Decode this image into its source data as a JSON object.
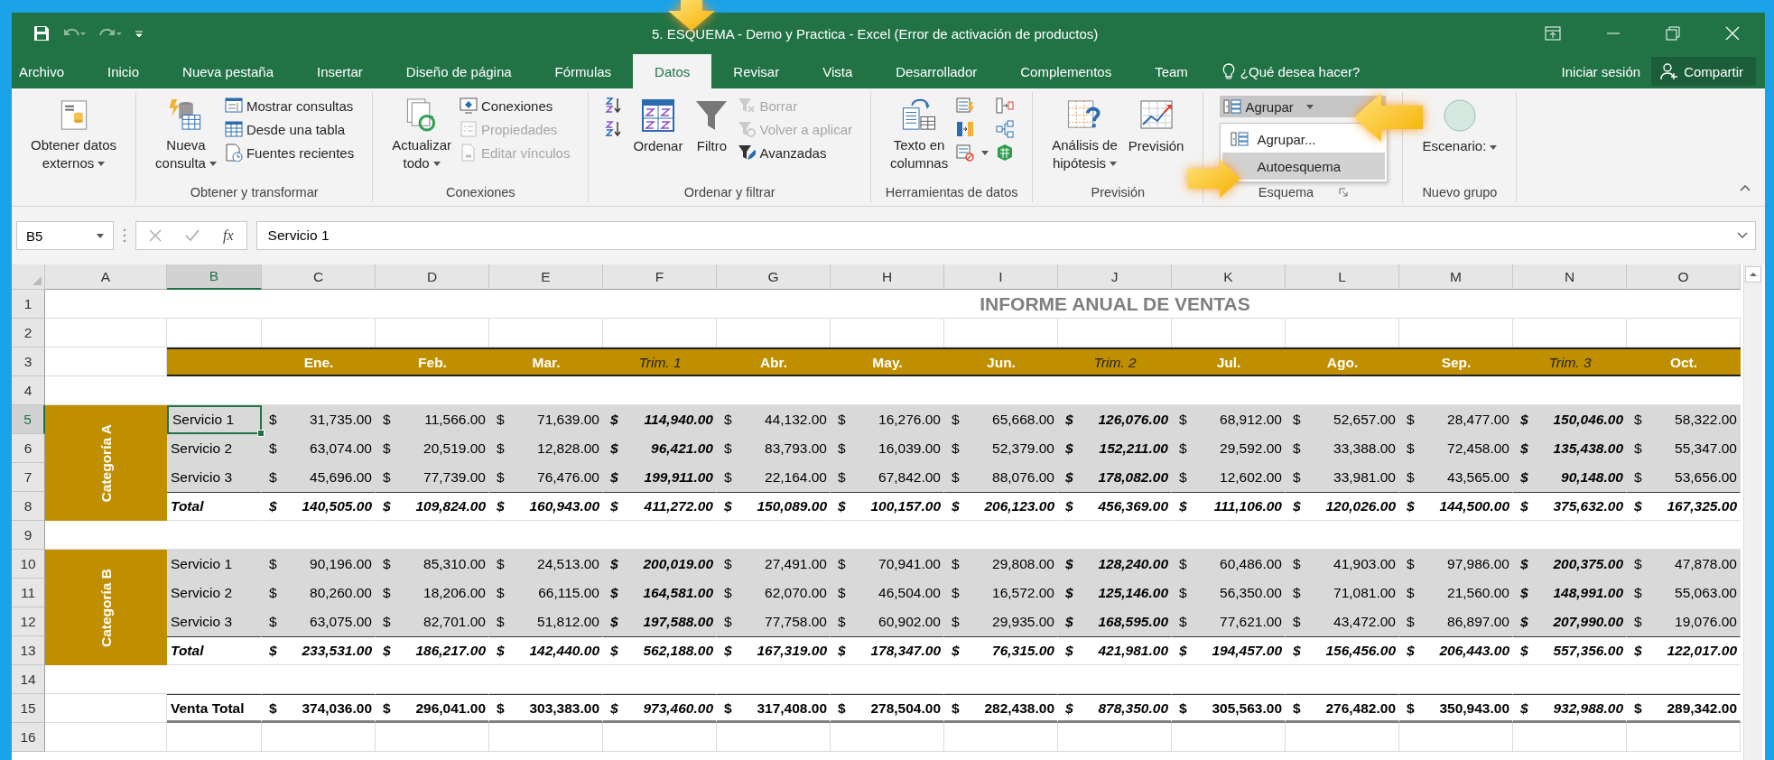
{
  "window": {
    "title": "5. ESQUEMA - Demo y Practica - Excel (Error de activación de productos)"
  },
  "menu_tabs": [
    {
      "label": "Archivo",
      "selected": false
    },
    {
      "label": "Inicio",
      "selected": false
    },
    {
      "label": "Nueva pestaña",
      "selected": false
    },
    {
      "label": "Insertar",
      "selected": false
    },
    {
      "label": "Diseño de página",
      "selected": false
    },
    {
      "label": "Fórmulas",
      "selected": false
    },
    {
      "label": "Datos",
      "selected": true
    },
    {
      "label": "Revisar",
      "selected": false
    },
    {
      "label": "Vista",
      "selected": false
    },
    {
      "label": "Desarrollador",
      "selected": false
    },
    {
      "label": "Complementos",
      "selected": false
    },
    {
      "label": "Team",
      "selected": false
    }
  ],
  "tell_me": {
    "placeholder": "¿Qué desea hacer?"
  },
  "account": {
    "sign_in": "Iniciar sesión",
    "share": "Compartir"
  },
  "ribbon": {
    "groups": [
      {
        "items": [
          {
            "kind": "large",
            "label": "Obtener datos\nexternos",
            "dropdown": true,
            "disabled": false
          }
        ]
      },
      {
        "label": "Obtener y transformar",
        "items": [
          {
            "kind": "large",
            "label": "Nueva\nconsulta",
            "dropdown": true,
            "disabled": false
          },
          {
            "kind": "small",
            "label": "Mostrar consultas",
            "disabled": false
          },
          {
            "kind": "small",
            "label": "Desde una tabla",
            "disabled": false
          },
          {
            "kind": "small",
            "label": "Fuentes recientes",
            "disabled": false
          }
        ]
      },
      {
        "label": "Conexiones",
        "items": [
          {
            "kind": "large",
            "label": "Actualizar\ntodo",
            "dropdown": true,
            "disabled": false
          },
          {
            "kind": "small",
            "label": "Conexiones",
            "disabled": false
          },
          {
            "kind": "small",
            "label": "Propiedades",
            "disabled": true
          },
          {
            "kind": "small",
            "label": "Editar vínculos",
            "disabled": true
          }
        ]
      },
      {
        "label": "Ordenar y filtrar",
        "items": [
          {
            "kind": "icon",
            "disabled": false
          },
          {
            "kind": "icon",
            "disabled": false
          },
          {
            "kind": "large",
            "label": "Ordenar",
            "disabled": false
          },
          {
            "kind": "large",
            "label": "Filtro",
            "disabled": false
          },
          {
            "kind": "small",
            "label": "Borrar",
            "disabled": true
          },
          {
            "kind": "small",
            "label": "Volver a aplicar",
            "disabled": true
          },
          {
            "kind": "small",
            "label": "Avanzadas",
            "disabled": false
          }
        ]
      },
      {
        "label": "Herramientas de datos",
        "items": [
          {
            "kind": "large",
            "label": "Texto en\ncolumnas",
            "disabled": false
          },
          {
            "kind": "icon",
            "disabled": false
          },
          {
            "kind": "icon",
            "disabled": false
          },
          {
            "kind": "icon",
            "dropdown": true,
            "disabled": false
          },
          {
            "kind": "icon",
            "disabled": false
          },
          {
            "kind": "icon",
            "disabled": false
          },
          {
            "kind": "icon",
            "disabled": false
          }
        ]
      },
      {
        "label": "Previsión",
        "items": [
          {
            "kind": "large",
            "label": "Análisis de\nhipótesis",
            "dropdown": true,
            "disabled": false
          },
          {
            "kind": "large",
            "label": "Previsión",
            "disabled": false
          }
        ]
      },
      {
        "label": "Esquema",
        "launcher": true,
        "items": [
          {
            "kind": "split",
            "label": "Agrupar",
            "expanded": true,
            "menu": [
              {
                "label": "Agrupar...",
                "selected": false
              },
              {
                "label": "Autoesquema",
                "selected": true
              }
            ]
          }
        ]
      },
      {
        "label": "Nuevo grupo",
        "items": [
          {
            "kind": "large",
            "label": "Escenario:",
            "dropdown": true,
            "disabled": false
          }
        ]
      }
    ]
  },
  "formula_bar": {
    "name_box": "B5",
    "function_label": "fx",
    "value": "Servicio 1"
  },
  "sheet": {
    "columns": [
      {
        "label": "A",
        "selected": false
      },
      {
        "label": "B",
        "selected": true
      },
      {
        "label": "C",
        "selected": false
      },
      {
        "label": "D",
        "selected": false
      },
      {
        "label": "E",
        "selected": false
      },
      {
        "label": "F",
        "selected": false
      },
      {
        "label": "G",
        "selected": false
      },
      {
        "label": "H",
        "selected": false
      },
      {
        "label": "I",
        "selected": false
      },
      {
        "label": "J",
        "selected": false
      },
      {
        "label": "K",
        "selected": false
      },
      {
        "label": "L",
        "selected": false
      },
      {
        "label": "M",
        "selected": false
      },
      {
        "label": "N",
        "selected": false
      },
      {
        "label": "O",
        "selected": false
      }
    ],
    "row_numbers": [
      {
        "label": "1",
        "selected": false
      },
      {
        "label": "2",
        "selected": false
      },
      {
        "label": "3",
        "selected": false
      },
      {
        "label": "4",
        "selected": false
      },
      {
        "label": "5",
        "selected": true
      },
      {
        "label": "6",
        "selected": false
      },
      {
        "label": "7",
        "selected": false
      },
      {
        "label": "8",
        "selected": false
      },
      {
        "label": "9",
        "selected": false
      },
      {
        "label": "10",
        "selected": false
      },
      {
        "label": "11",
        "selected": false
      },
      {
        "label": "12",
        "selected": false
      },
      {
        "label": "13",
        "selected": false
      },
      {
        "label": "14",
        "selected": false
      },
      {
        "label": "15",
        "selected": false
      },
      {
        "label": "16",
        "selected": false
      }
    ],
    "title": "INFORME ANUAL DE VENTAS",
    "headers": [
      {
        "label": "Ene.",
        "kind": "month"
      },
      {
        "label": "Feb.",
        "kind": "month"
      },
      {
        "label": "Mar.",
        "kind": "month"
      },
      {
        "label": "Trim. 1",
        "kind": "quarter"
      },
      {
        "label": "Abr.",
        "kind": "month"
      },
      {
        "label": "May.",
        "kind": "month"
      },
      {
        "label": "Jun.",
        "kind": "month"
      },
      {
        "label": "Trim. 2",
        "kind": "quarter"
      },
      {
        "label": "Jul.",
        "kind": "month"
      },
      {
        "label": "Ago.",
        "kind": "month"
      },
      {
        "label": "Sep.",
        "kind": "month"
      },
      {
        "label": "Trim. 3",
        "kind": "quarter"
      },
      {
        "label": "Oct.",
        "kind": "month"
      }
    ],
    "groups": [
      {
        "label": "Categoría A",
        "rows": [
          {
            "label": "Servicio 1",
            "selected": true,
            "cells": [
              [
                "$",
                "31,735.00"
              ],
              [
                "$",
                "11,566.00"
              ],
              [
                "$",
                "71,639.00"
              ],
              [
                "$",
                "114,940.00"
              ],
              [
                "$",
                "44,132.00"
              ],
              [
                "$",
                "16,276.00"
              ],
              [
                "$",
                "65,668.00"
              ],
              [
                "$",
                "126,076.00"
              ],
              [
                "$",
                "68,912.00"
              ],
              [
                "$",
                "52,657.00"
              ],
              [
                "$",
                "28,477.00"
              ],
              [
                "$",
                "150,046.00"
              ],
              [
                "$",
                "58,322.00"
              ]
            ]
          },
          {
            "label": "Servicio 2",
            "selected": false,
            "cells": [
              [
                "$",
                "63,074.00"
              ],
              [
                "$",
                "20,519.00"
              ],
              [
                "$",
                "12,828.00"
              ],
              [
                "$",
                "96,421.00"
              ],
              [
                "$",
                "83,793.00"
              ],
              [
                "$",
                "16,039.00"
              ],
              [
                "$",
                "52,379.00"
              ],
              [
                "$",
                "152,211.00"
              ],
              [
                "$",
                "29,592.00"
              ],
              [
                "$",
                "33,388.00"
              ],
              [
                "$",
                "72,458.00"
              ],
              [
                "$",
                "135,438.00"
              ],
              [
                "$",
                "55,347.00"
              ]
            ]
          },
          {
            "label": "Servicio 3",
            "selected": false,
            "cells": [
              [
                "$",
                "45,696.00"
              ],
              [
                "$",
                "77,739.00"
              ],
              [
                "$",
                "76,476.00"
              ],
              [
                "$",
                "199,911.00"
              ],
              [
                "$",
                "22,164.00"
              ],
              [
                "$",
                "67,842.00"
              ],
              [
                "$",
                "88,076.00"
              ],
              [
                "$",
                "178,082.00"
              ],
              [
                "$",
                "12,602.00"
              ],
              [
                "$",
                "33,981.00"
              ],
              [
                "$",
                "43,565.00"
              ],
              [
                "$",
                "90,148.00"
              ],
              [
                "$",
                "53,656.00"
              ]
            ]
          }
        ],
        "total": {
          "label": "Total",
          "cells": [
            [
              "$",
              "140,505.00"
            ],
            [
              "$",
              "109,824.00"
            ],
            [
              "$",
              "160,943.00"
            ],
            [
              "$",
              "411,272.00"
            ],
            [
              "$",
              "150,089.00"
            ],
            [
              "$",
              "100,157.00"
            ],
            [
              "$",
              "206,123.00"
            ],
            [
              "$",
              "456,369.00"
            ],
            [
              "$",
              "111,106.00"
            ],
            [
              "$",
              "120,026.00"
            ],
            [
              "$",
              "144,500.00"
            ],
            [
              "$",
              "375,632.00"
            ],
            [
              "$",
              "167,325.00"
            ]
          ]
        }
      },
      {
        "label": "Categoría B",
        "rows": [
          {
            "label": "Servicio 1",
            "selected": false,
            "cells": [
              [
                "$",
                "90,196.00"
              ],
              [
                "$",
                "85,310.00"
              ],
              [
                "$",
                "24,513.00"
              ],
              [
                "$",
                "200,019.00"
              ],
              [
                "$",
                "27,491.00"
              ],
              [
                "$",
                "70,941.00"
              ],
              [
                "$",
                "29,808.00"
              ],
              [
                "$",
                "128,240.00"
              ],
              [
                "$",
                "60,486.00"
              ],
              [
                "$",
                "41,903.00"
              ],
              [
                "$",
                "97,986.00"
              ],
              [
                "$",
                "200,375.00"
              ],
              [
                "$",
                "47,878.00"
              ]
            ]
          },
          {
            "label": "Servicio 2",
            "selected": false,
            "cells": [
              [
                "$",
                "80,260.00"
              ],
              [
                "$",
                "18,206.00"
              ],
              [
                "$",
                "66,115.00"
              ],
              [
                "$",
                "164,581.00"
              ],
              [
                "$",
                "62,070.00"
              ],
              [
                "$",
                "46,504.00"
              ],
              [
                "$",
                "16,572.00"
              ],
              [
                "$",
                "125,146.00"
              ],
              [
                "$",
                "56,350.00"
              ],
              [
                "$",
                "71,081.00"
              ],
              [
                "$",
                "21,560.00"
              ],
              [
                "$",
                "148,991.00"
              ],
              [
                "$",
                "55,063.00"
              ]
            ]
          },
          {
            "label": "Servicio 3",
            "selected": false,
            "cells": [
              [
                "$",
                "63,075.00"
              ],
              [
                "$",
                "82,701.00"
              ],
              [
                "$",
                "51,812.00"
              ],
              [
                "$",
                "197,588.00"
              ],
              [
                "$",
                "77,758.00"
              ],
              [
                "$",
                "60,902.00"
              ],
              [
                "$",
                "29,935.00"
              ],
              [
                "$",
                "168,595.00"
              ],
              [
                "$",
                "77,621.00"
              ],
              [
                "$",
                "43,472.00"
              ],
              [
                "$",
                "86,897.00"
              ],
              [
                "$",
                "207,990.00"
              ],
              [
                "$",
                "19,076.00"
              ]
            ]
          }
        ],
        "total": {
          "label": "Total",
          "cells": [
            [
              "$",
              "233,531.00"
            ],
            [
              "$",
              "186,217.00"
            ],
            [
              "$",
              "142,440.00"
            ],
            [
              "$",
              "562,188.00"
            ],
            [
              "$",
              "167,319.00"
            ],
            [
              "$",
              "178,347.00"
            ],
            [
              "$",
              "76,315.00"
            ],
            [
              "$",
              "421,981.00"
            ],
            [
              "$",
              "194,457.00"
            ],
            [
              "$",
              "156,456.00"
            ],
            [
              "$",
              "206,443.00"
            ],
            [
              "$",
              "557,356.00"
            ],
            [
              "$",
              "122,017.00"
            ]
          ]
        }
      }
    ],
    "grand_total": {
      "label": "Venta Total",
      "cells": [
        [
          "$",
          "374,036.00"
        ],
        [
          "$",
          "296,041.00"
        ],
        [
          "$",
          "303,383.00"
        ],
        [
          "$",
          "973,460.00"
        ],
        [
          "$",
          "317,408.00"
        ],
        [
          "$",
          "278,504.00"
        ],
        [
          "$",
          "282,438.00"
        ],
        [
          "$",
          "878,350.00"
        ],
        [
          "$",
          "305,563.00"
        ],
        [
          "$",
          "276,482.00"
        ],
        [
          "$",
          "350,943.00"
        ],
        [
          "$",
          "932,988.00"
        ],
        [
          "$",
          "289,342.00"
        ]
      ]
    }
  }
}
